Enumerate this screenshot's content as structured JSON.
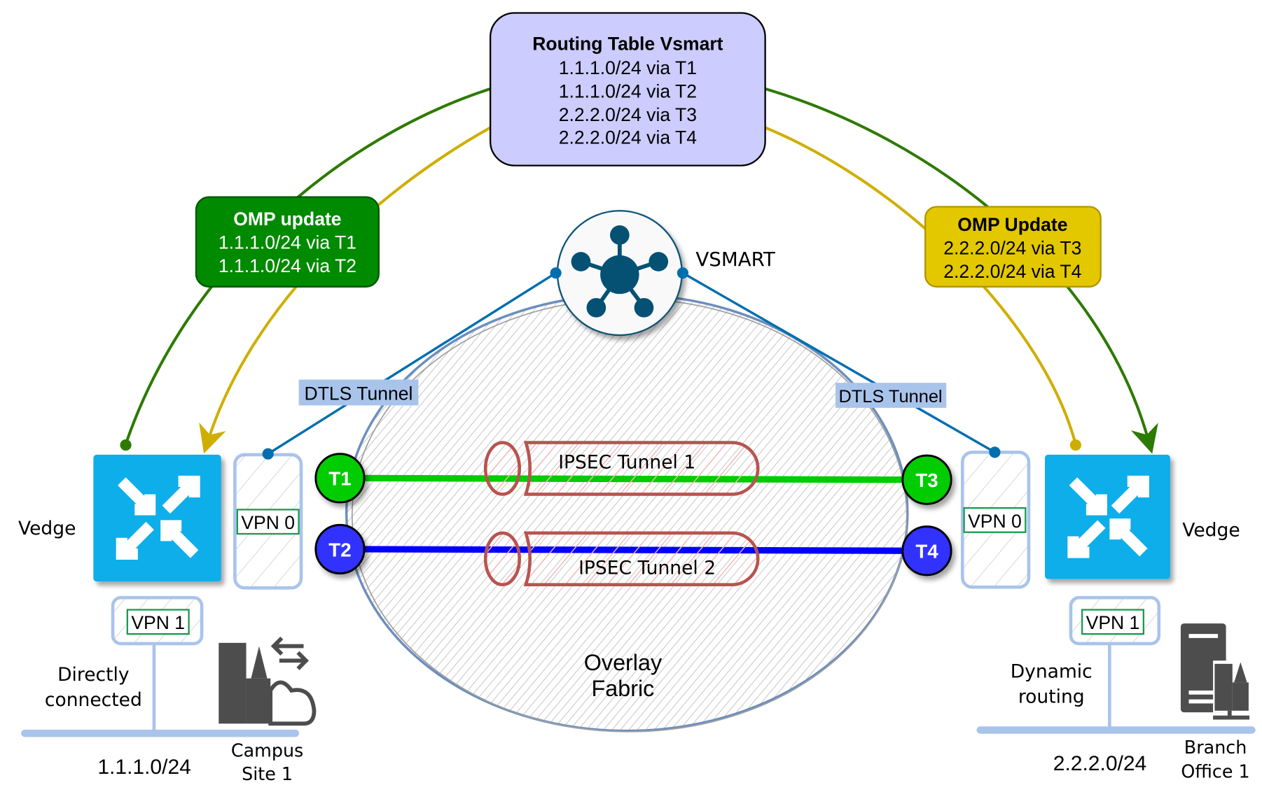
{
  "routing_table": {
    "title": "Routing Table Vsmart",
    "routes": [
      "1.1.1.0/24 via T1",
      "1.1.1.0/24 via T2",
      "2.2.2.0/24 via T3",
      "2.2.2.0/24 via T4"
    ],
    "fill": "#ccccff"
  },
  "omp_left": {
    "title": "OMP update",
    "routes": [
      "1.1.1.0/24 via T1",
      "1.1.1.0/24 via T2"
    ],
    "fill": "#008a00"
  },
  "omp_right": {
    "title": "OMP Update",
    "routes": [
      "2.2.2.0/24 via T3",
      "2.2.2.0/24 via T4"
    ],
    "fill": "#e3c800"
  },
  "vsmart": {
    "label": "VSMART",
    "icon": "hub-network-icon"
  },
  "dtls": {
    "left": "DTLS Tunnel",
    "right": "DTLS Tunnel"
  },
  "tunnels": {
    "t1": "T1",
    "t2": "T2",
    "t3": "T3",
    "t4": "T4",
    "ipsec1": "IPSEC Tunnel 1",
    "ipsec2": "IPSEC Tunnel 2"
  },
  "overlay": {
    "line1": "Overlay",
    "line2": "Fabric"
  },
  "left_site": {
    "vedge": "Vedge",
    "vpn0": "VPN 0",
    "vpn1": "VPN 1",
    "routing1": "Directly",
    "routing2": "connected",
    "subnet": "1.1.1.0/24",
    "site1": "Campus",
    "site2": "Site 1"
  },
  "right_site": {
    "vedge": "Vedge",
    "vpn0": "VPN 0",
    "vpn1": "VPN 1",
    "routing1": "Dynamic",
    "routing2": "routing",
    "subnet": "2.2.2.0/24",
    "site1": "Branch",
    "site2": "Office 1"
  },
  "colors": {
    "green_link": "#2d7a00",
    "yellow_link": "#cfae00",
    "dtls": "#006eaf",
    "t1_t3": "#00cc00",
    "t2_t4": "#3333ff",
    "vedge": "#0aaeea"
  }
}
